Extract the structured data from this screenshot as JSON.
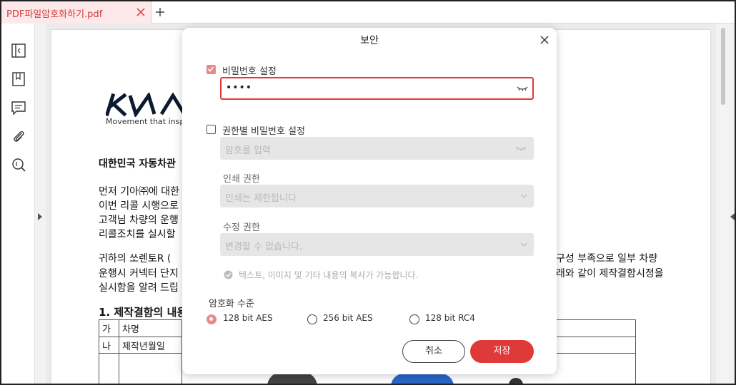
{
  "tab": {
    "title": "PDF파일암호화하기.pdf"
  },
  "icons": {
    "tab_close": "close-icon",
    "tab_add": "plus-icon",
    "sidebar": [
      "panel-icon",
      "bookmark-icon",
      "comment-icon",
      "attachment-icon",
      "search-icon"
    ],
    "modal_close": "close-icon",
    "eye": "eye-closed-icon"
  },
  "document": {
    "logo_tagline": "Movement that inspire",
    "heading": "대한민국 자동차관",
    "para1": [
      "먼저 기아㈜에 대한",
      "이번 리콜 시행으로",
      "고객님 차량의 운행",
      "리콜조치를 실시할"
    ],
    "para2": [
      "귀하의 쏘렌토R (",
      "운행시 커넥터 단지",
      "실시함을 알려 드립"
    ],
    "para2_right": [
      "구성 부족으로 일부 차량",
      "래와 같이 제작결함시정을"
    ],
    "section": "1. 제작결함의 내용",
    "table_rows": [
      {
        "key": "가",
        "label": "차명"
      },
      {
        "key": "나",
        "label": "제작년월일"
      }
    ]
  },
  "modal": {
    "title": "보안",
    "password": {
      "label": "비밀번호 설정",
      "checked": true,
      "value": "••••"
    },
    "permission": {
      "label": "권한별 비밀번호 설정",
      "checked": false,
      "placeholder": "암호를 입력",
      "print_label": "인쇄 권한",
      "print_value": "인쇄는 제한됩니다",
      "edit_label": "수정 권한",
      "edit_value": "변경할 수 없습니다.",
      "copy_note": "텍스트, 이미지 및 기타 내용의 복사가 가능합니다."
    },
    "encryption": {
      "label": "암호화 수준",
      "options": [
        "128 bit AES",
        "256 bit AES",
        "128 bit RC4"
      ],
      "selected": "128 bit AES"
    },
    "buttons": {
      "cancel": "취소",
      "save": "저장"
    }
  },
  "colors": {
    "accent": "#e0393a",
    "accent_soft": "#e98a8a",
    "tab_bg": "#fde9e9"
  }
}
